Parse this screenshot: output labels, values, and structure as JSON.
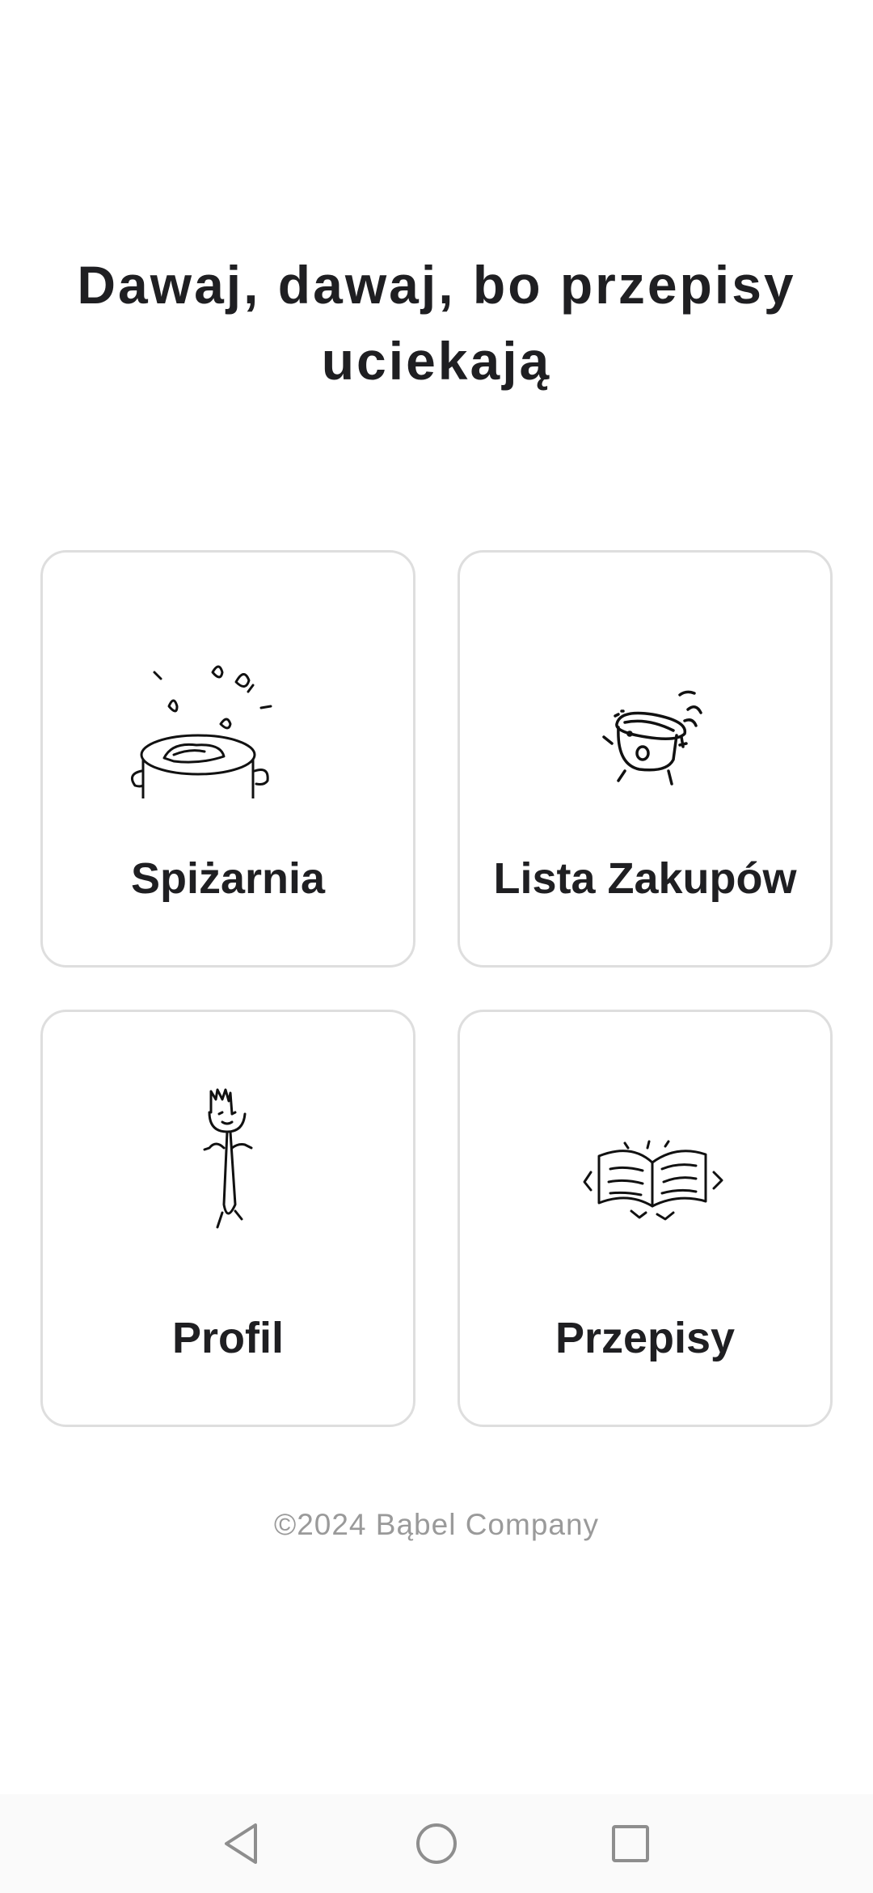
{
  "header": {
    "title": "Dawaj, dawaj, bo przepisy uciekają"
  },
  "menu": {
    "cards": [
      {
        "label": "Spiżarnia",
        "icon": "cooking-pot-icon"
      },
      {
        "label": "Lista Zakupów",
        "icon": "shopping-bowl-icon"
      },
      {
        "label": "Profil",
        "icon": "fork-character-icon"
      },
      {
        "label": "Przepisy",
        "icon": "open-book-icon"
      }
    ]
  },
  "footer": {
    "copyright": "©2024 Bąbel Company"
  },
  "system_nav": {
    "buttons": [
      "back-icon",
      "home-icon",
      "recents-icon"
    ]
  },
  "colors": {
    "text": "#1f1f22",
    "card_border": "#dedede",
    "footer_text": "#9a9a9a",
    "nav_background": "#fafafa"
  }
}
